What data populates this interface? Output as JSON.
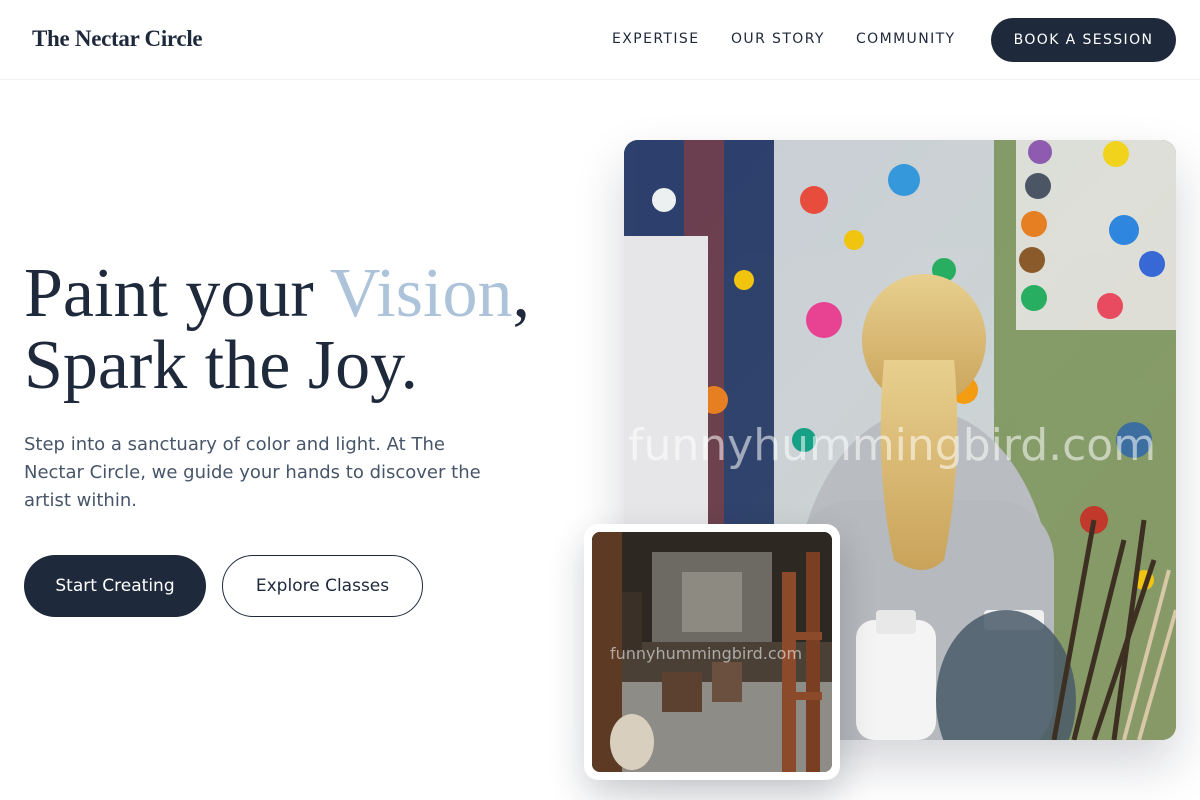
{
  "brand": {
    "name": "The Nectar Circle"
  },
  "nav": {
    "items": [
      {
        "label": "EXPERTISE"
      },
      {
        "label": "OUR STORY"
      },
      {
        "label": "COMMUNITY"
      }
    ],
    "cta_label": "BOOK A SESSION"
  },
  "hero": {
    "headline_part1": "Paint your ",
    "headline_accent": "Vision",
    "headline_part2": ",",
    "headline_line2": "Spark the Joy.",
    "subtext": "Step into a sanctuary of color and light. At The Nectar Circle, we guide your hands to discover the artist within.",
    "primary_cta": "Start Creating",
    "secondary_cta": "Explore Classes"
  },
  "images": {
    "main_watermark": "funnyhummingbird.com",
    "small_watermark": "funnyhummingbird.com"
  },
  "colors": {
    "primary": "#1e293b",
    "accent": "#adc3da",
    "body_text": "#475569"
  }
}
